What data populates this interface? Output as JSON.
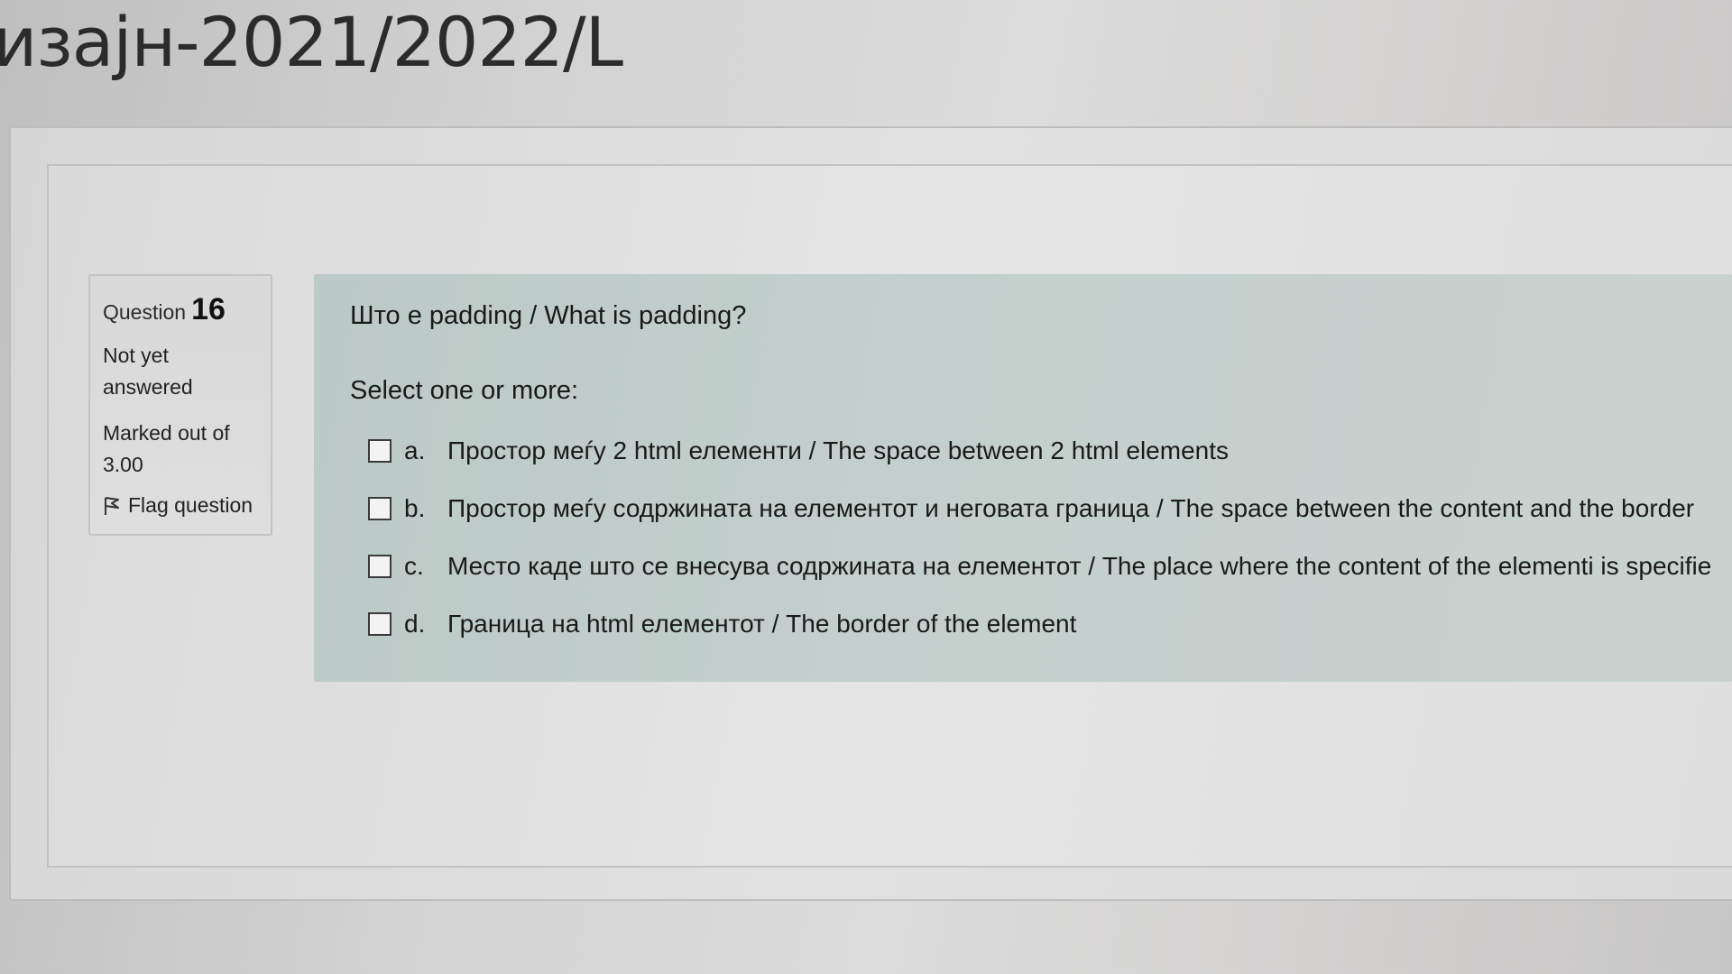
{
  "page": {
    "title": "изајн-2021/2022/L"
  },
  "question_info": {
    "label": "Question",
    "number": "16",
    "state": "Not yet answered",
    "mark": "Marked out of 3.00",
    "flag_label": "Flag question"
  },
  "question": {
    "text": "Што е padding / What is padding?",
    "prompt": "Select one or more:",
    "answers": [
      {
        "letter": "a.",
        "text": "Простор меѓу 2 html елементи / The space between 2 html elements",
        "checked": false
      },
      {
        "letter": "b.",
        "text": "Простор меѓу содржината на елементот и неговата граница / The space between the content and the border",
        "checked": false
      },
      {
        "letter": "c.",
        "text": "Место каде што се внесува содржината на елементот / The place where the content of the elementi is specifie",
        "checked": false
      },
      {
        "letter": "d.",
        "text": "Граница на html елементот / The border of the element",
        "checked": false
      }
    ]
  },
  "icons": {
    "flag": "flag-icon",
    "checkbox": "checkbox-icon"
  },
  "colors": {
    "content_background": "#c2cfcc",
    "info_background": "#dadada",
    "text": "#1a1a1a"
  }
}
